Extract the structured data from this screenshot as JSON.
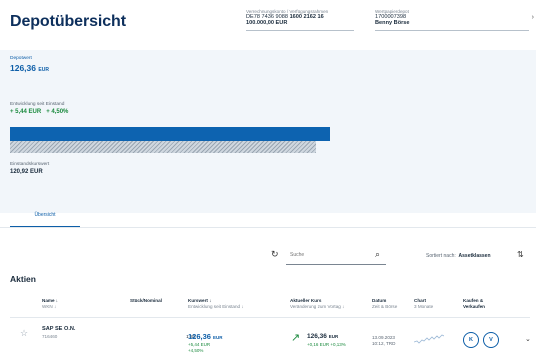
{
  "header": {
    "title": "Depotübersicht",
    "account": {
      "label": "Verrechnungskonto / Verfügungsrahmen",
      "iban_prefix": "DE78 7436 9088",
      "iban_bold": "1600 2162 16",
      "amount": "100.000,00 EUR"
    },
    "depot": {
      "label": "Wertpapierdepot",
      "number": "1700007398",
      "owner": "Benny Börse"
    },
    "chevron": "›"
  },
  "summary": {
    "depotwert_label": "Depotwert",
    "depotwert_value": "126,36",
    "depotwert_unit": "EUR",
    "entwicklung_label": "Entwicklung seit Einstand",
    "entwicklung_abs": "+ 5,44 EUR",
    "entwicklung_pct": "+ 4,50%",
    "einstand_label": "Einstandskurswert",
    "einstand_value": "120,92 EUR",
    "bar_current_value": 126.36,
    "bar_einstand_value": 120.92,
    "bar_color": "#0d63b0"
  },
  "tabs": [
    {
      "label": "Übersicht",
      "active": true
    }
  ],
  "toolbar": {
    "search_placeholder": "Suche",
    "sort_prefix": "Sortiert nach:",
    "sort_value": "Assetklassen"
  },
  "section": {
    "title": "Aktien"
  },
  "columns": {
    "name": {
      "title": "Name ↓",
      "sub": "WKN ↓"
    },
    "stueck": {
      "title": "Stück/Nominal"
    },
    "kurswert": {
      "title": "Kurswert ↓",
      "sub": "Entwicklung seit Einstand ↓"
    },
    "kurs": {
      "title": "Aktueller Kurs",
      "sub": "Veränderung zum Vortag ↓"
    },
    "datum": {
      "title": "Datum",
      "sub": "Zeit & Börse"
    },
    "chart": {
      "title": "Chart",
      "sub": "3 Monate"
    },
    "trade": {
      "title": "Kaufen &",
      "sub": "Verkaufen"
    }
  },
  "rows": [
    {
      "name": "SAP SE O.N.",
      "wkn": "716460",
      "stueck": "1 St.",
      "kurswert": "126,36",
      "kurswert_unit": "EUR",
      "entw_abs": "+5,44 EUR",
      "entw_pct": "+4,50%",
      "kurs": "126,36",
      "kurs_unit": "EUR",
      "kurs_change": "+0,16 EUR  +0,13%",
      "datum": "13.09.2023",
      "zeit": "10:12, TRD",
      "btn_kaufen": "K",
      "btn_verkaufen": "V"
    }
  ],
  "colors": {
    "accent": "#0d5ea8",
    "positive": "#1b8a3e",
    "title": "#0d2f5c"
  }
}
